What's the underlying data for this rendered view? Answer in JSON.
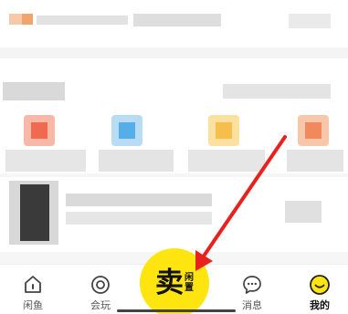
{
  "nav": {
    "items": [
      {
        "label": "闲鱼",
        "icon": "home-icon"
      },
      {
        "label": "会玩",
        "icon": "play-circle-icon"
      },
      {
        "label": "消息",
        "icon": "message-bubble-icon"
      },
      {
        "label": "我的",
        "icon": "smiley-face-icon"
      }
    ],
    "active": "我的"
  },
  "sell_button": {
    "main": "卖",
    "sub_top": "闲",
    "sub_bottom": "置"
  },
  "colors": {
    "accent_yellow": "#ffe510",
    "annotation_arrow": "#e8211c",
    "nav_text": "#555555",
    "nav_text_active": "#111111"
  }
}
